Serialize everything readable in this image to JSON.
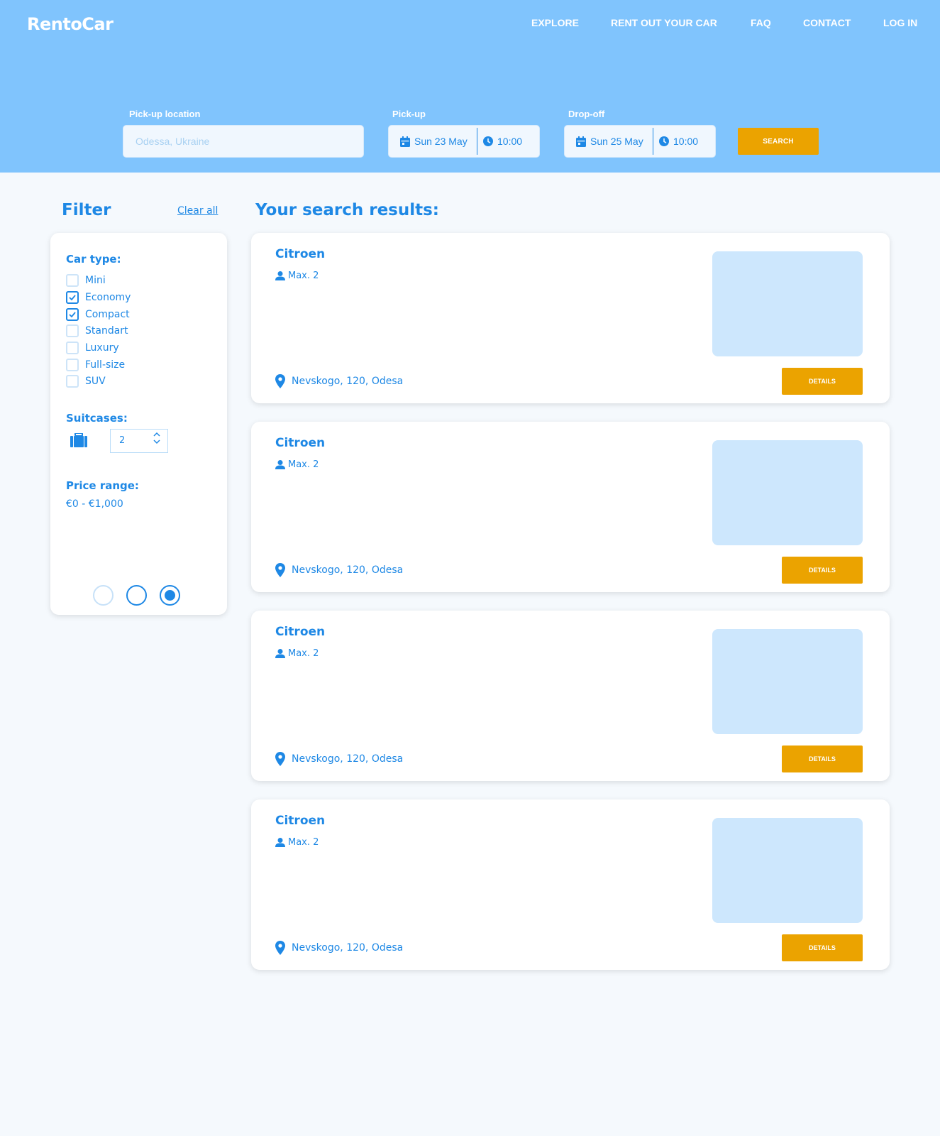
{
  "header": {
    "logo": "RentoCar",
    "nav": {
      "explore": "EXPLORE",
      "rent_out": "RENT OUT YOUR CAR",
      "faq": "FAQ",
      "contact": "CONTACT",
      "login": "LOG IN"
    }
  },
  "search": {
    "pickup_location_label": "Pick-up location",
    "pickup_location_placeholder": "Odessa, Ukraine",
    "pickup_label": "Pick-up",
    "pickup_date": "Sun 23 May",
    "pickup_time": "10:00",
    "dropoff_label": "Drop-off",
    "dropoff_date": "Sun 25 May",
    "dropoff_time": "10:00",
    "search_button": "SEARCH"
  },
  "filter": {
    "title": "Filter",
    "clear_all": "Clear all",
    "car_type_title": "Car type:",
    "car_types": [
      {
        "label": "Mini",
        "checked": false
      },
      {
        "label": "Economy",
        "checked": true
      },
      {
        "label": "Compact",
        "checked": true
      },
      {
        "label": "Standart",
        "checked": false
      },
      {
        "label": "Luxury",
        "checked": false
      },
      {
        "label": "Full-size",
        "checked": false
      },
      {
        "label": "SUV",
        "checked": false
      }
    ],
    "suitcases_title": "Suitcases:",
    "suitcases_value": "2",
    "price_range_title": "Price range:",
    "price_range_value": "€0 - €1,000",
    "radio_selected": 3
  },
  "results": {
    "title": "Your search results:",
    "cards": [
      {
        "name": "Citroen",
        "capacity": "Max. 2",
        "address": "Nevskogo, 120, Odesa",
        "button": "DETAILS"
      },
      {
        "name": "Citroen",
        "capacity": "Max. 2",
        "address": "Nevskogo, 120, Odesa",
        "button": "DETAILS"
      },
      {
        "name": "Citroen",
        "capacity": "Max. 2",
        "address": "Nevskogo, 120, Odesa",
        "button": "DETAILS"
      },
      {
        "name": "Citroen",
        "capacity": "Max. 2",
        "address": "Nevskogo, 120, Odesa",
        "button": "DETAILS"
      }
    ]
  },
  "colors": {
    "header_bg": "#80c4fd",
    "primary": "#1e88e5",
    "accent": "#eba300",
    "page_bg": "#f5f9fd",
    "thumb_bg": "#cde7fd"
  }
}
